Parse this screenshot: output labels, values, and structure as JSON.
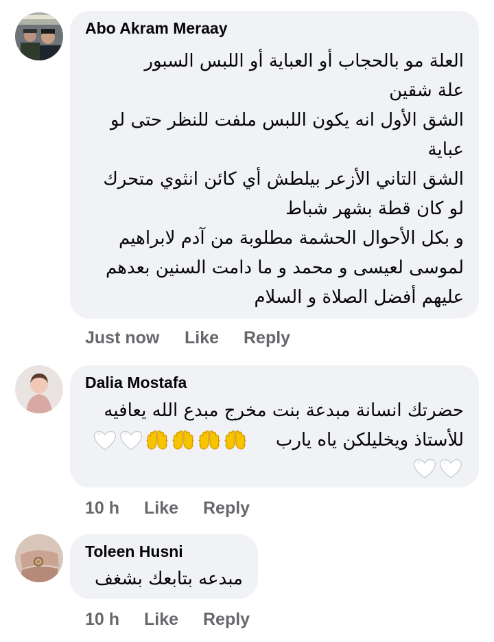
{
  "comments": [
    {
      "author": "Abo Akram Meraay",
      "lines": [
        "العلة مو بالحجاب أو العباية أو اللبس السبور",
        "علة شقين",
        "الشق الأول انه يكون اللبس ملفت للنظر حتى لو",
        "عباية",
        "الشق التاني الأزعر بيلطش أي كائن انثوي متحرك",
        "لو كان قطة بشهر شباط",
        "و بكل الأحوال الحشمة مطلوبة من آدم لابراهيم",
        "لموسى لعيسى و محمد و ما دامت السنين بعدهم",
        "عليهم أفضل الصلاة و السلام"
      ],
      "time": "Just now",
      "like": "Like",
      "reply": "Reply"
    },
    {
      "author": "Dalia Mostafa",
      "lines": [
        "حضرتك انسانة مبدعة بنت مخرج مبدع الله يعافيه",
        "للأستاذ  ويخليلكن ياه يارب"
      ],
      "time": "10 h",
      "like": "Like",
      "reply": "Reply"
    },
    {
      "author": "Toleen Husni",
      "lines": [
        "مبدعه بتابعك بشغف"
      ],
      "time": "10 h",
      "like": "Like",
      "reply": "Reply"
    }
  ],
  "icons": {
    "hands": "raising-hands-icon",
    "heart": "white-heart-icon"
  },
  "colors": {
    "bubble": "#f0f2f5",
    "meta": "#65676b",
    "text": "#050505"
  }
}
